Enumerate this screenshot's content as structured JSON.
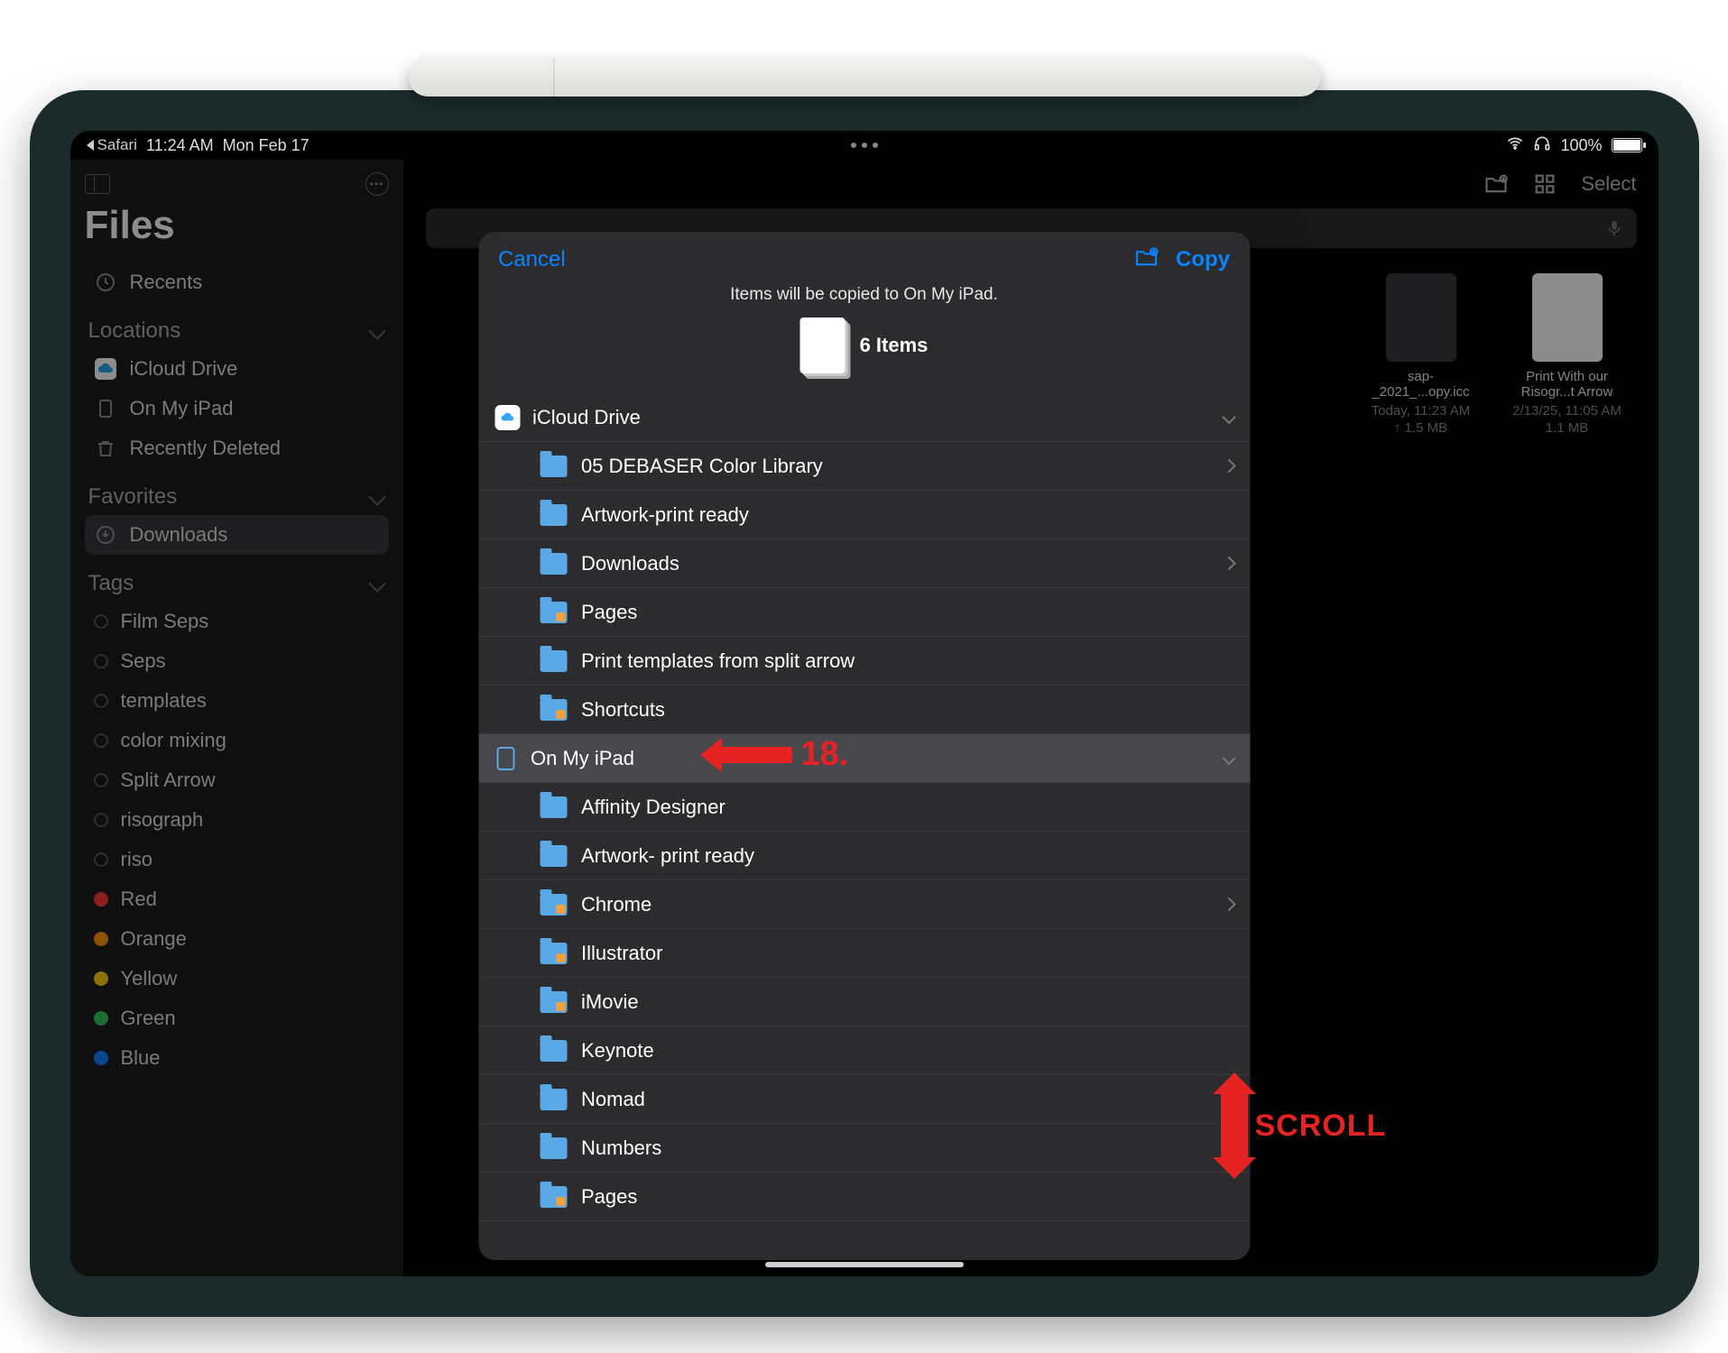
{
  "status": {
    "back_app": "Safari",
    "time": "11:24 AM",
    "date": "Mon Feb 17",
    "battery_pct": "100%"
  },
  "sidebar": {
    "title": "Files",
    "recents": "Recents",
    "sections": {
      "locations_label": "Locations",
      "favorites_label": "Favorites",
      "tags_label": "Tags"
    },
    "locations": [
      {
        "label": "iCloud Drive"
      },
      {
        "label": "On My iPad"
      },
      {
        "label": "Recently Deleted"
      }
    ],
    "favorites": [
      {
        "label": "Downloads"
      }
    ],
    "tags": [
      {
        "label": "Film Seps",
        "color": ""
      },
      {
        "label": "Seps",
        "color": ""
      },
      {
        "label": "templates",
        "color": ""
      },
      {
        "label": "color mixing",
        "color": ""
      },
      {
        "label": "Split Arrow",
        "color": ""
      },
      {
        "label": "risograph",
        "color": ""
      },
      {
        "label": "riso",
        "color": ""
      },
      {
        "label": "Red",
        "color": "#ff3b30"
      },
      {
        "label": "Orange",
        "color": "#ff9500"
      },
      {
        "label": "Yellow",
        "color": "#ffcc00"
      },
      {
        "label": "Green",
        "color": "#34c759"
      },
      {
        "label": "Blue",
        "color": "#0a84ff"
      }
    ]
  },
  "content_topbar": {
    "select_label": "Select"
  },
  "grid_items": [
    {
      "title": "sap-_2021_...opy.icc",
      "meta1": "Today, 11:23 AM",
      "meta2": "↑ 1.5 MB",
      "thumb": "gray"
    },
    {
      "title": "Print With our Risogr...t Arrow",
      "meta1": "2/13/25, 11:05 AM",
      "meta2": "1.1 MB",
      "thumb": "white"
    }
  ],
  "modal": {
    "cancel": "Cancel",
    "copy": "Copy",
    "subtitle": "Items will be copied to On My iPad.",
    "items_count": "6 Items",
    "rows": [
      {
        "lvl": 0,
        "icon": "cloud",
        "label": "iCloud Drive",
        "chev": "d"
      },
      {
        "lvl": 1,
        "icon": "folder",
        "label": "05 DEBASER Color Library",
        "chev": "r"
      },
      {
        "lvl": 1,
        "icon": "folder",
        "label": "Artwork-print ready",
        "chev": ""
      },
      {
        "lvl": 1,
        "icon": "folder",
        "label": "Downloads",
        "chev": "r"
      },
      {
        "lvl": 1,
        "icon": "folder-orange",
        "label": "Pages",
        "chev": ""
      },
      {
        "lvl": 1,
        "icon": "folder",
        "label": "Print templates from split arrow",
        "chev": ""
      },
      {
        "lvl": 1,
        "icon": "folder-orange",
        "label": "Shortcuts",
        "chev": ""
      },
      {
        "lvl": 0,
        "icon": "ipad",
        "label": "On My iPad",
        "chev": "d",
        "highlight": true
      },
      {
        "lvl": 1,
        "icon": "folder",
        "label": "Affinity Designer",
        "chev": ""
      },
      {
        "lvl": 1,
        "icon": "folder",
        "label": "Artwork- print ready",
        "chev": ""
      },
      {
        "lvl": 1,
        "icon": "folder-orange",
        "label": "Chrome",
        "chev": "r"
      },
      {
        "lvl": 1,
        "icon": "folder-orange",
        "label": "Illustrator",
        "chev": ""
      },
      {
        "lvl": 1,
        "icon": "folder-orange",
        "label": "iMovie",
        "chev": ""
      },
      {
        "lvl": 1,
        "icon": "folder",
        "label": "Keynote",
        "chev": ""
      },
      {
        "lvl": 1,
        "icon": "folder",
        "label": "Nomad",
        "chev": "r"
      },
      {
        "lvl": 1,
        "icon": "folder",
        "label": "Numbers",
        "chev": ""
      },
      {
        "lvl": 1,
        "icon": "folder-orange",
        "label": "Pages",
        "chev": ""
      }
    ]
  },
  "annotations": {
    "step_label": "18.",
    "scroll_label": "SCROLL"
  }
}
